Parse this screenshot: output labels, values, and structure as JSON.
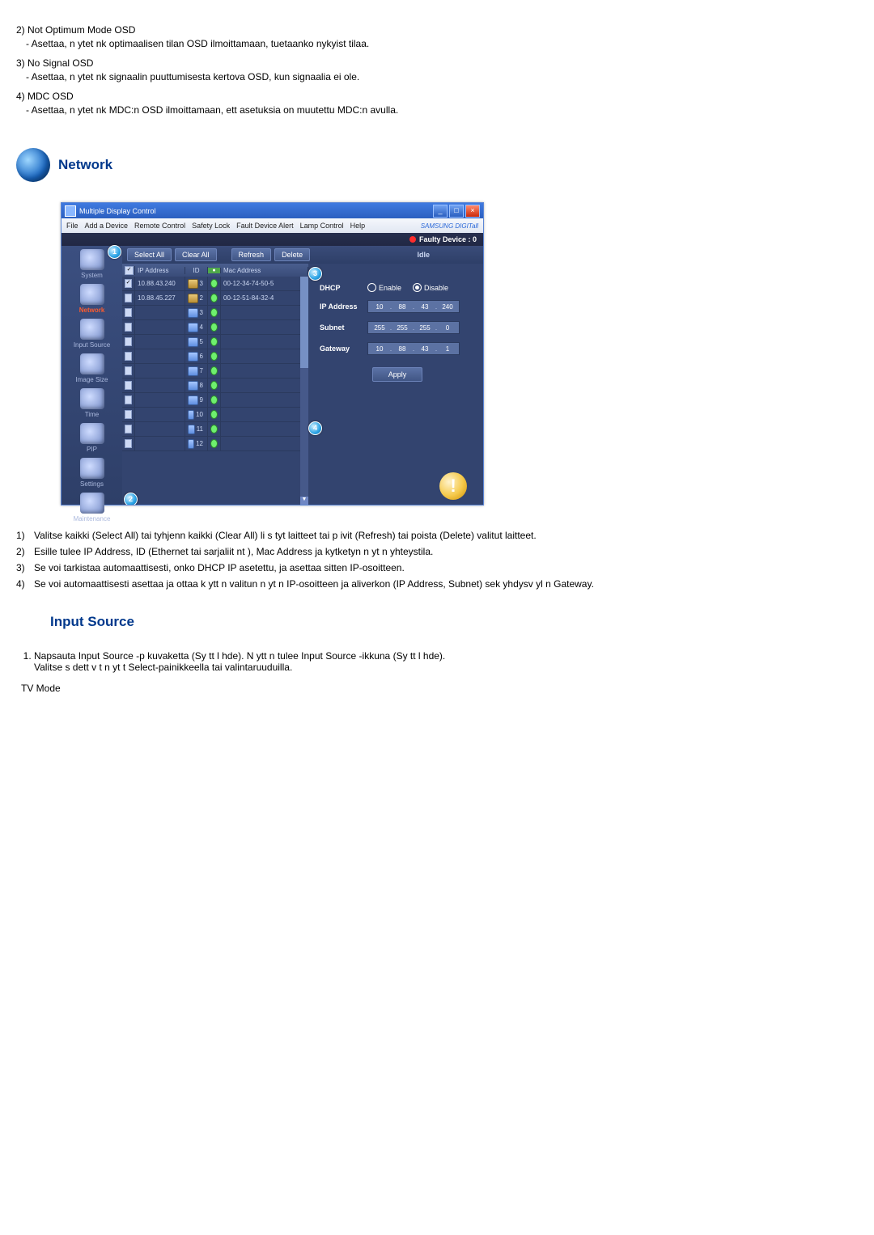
{
  "doc": {
    "items": [
      {
        "n": "2)",
        "title": "Not Optimum Mode OSD",
        "desc": "- Asettaa, n ytet  nk  optimaalisen tilan OSD ilmoittamaan, tuetaanko nykyist  tilaa."
      },
      {
        "n": "3)",
        "title": "No Signal OSD",
        "desc": "- Asettaa, n ytet  nk  signaalin puuttumisesta kertova OSD, kun signaalia ei ole."
      },
      {
        "n": "4)",
        "title": "MDC OSD",
        "desc": "- Asettaa, n ytet  nk  MDC:n OSD ilmoittamaan, ett  asetuksia on muutettu MDC:n avulla."
      }
    ]
  },
  "sections": {
    "network": "Network",
    "input_source": "Input Source"
  },
  "app": {
    "title": "Multiple Display Control",
    "menu": [
      "File",
      "Add a Device",
      "Remote Control",
      "Safety Lock",
      "Fault Device Alert",
      "Lamp Control",
      "Help"
    ],
    "brand": "SAMSUNG DIGITall",
    "faulty": "Faulty Device : 0",
    "toolbar": {
      "select_all": "Select All",
      "clear_all": "Clear All",
      "refresh": "Refresh",
      "delete": "Delete",
      "idle": "Idle"
    },
    "sidebar": [
      {
        "label": "System"
      },
      {
        "label": "Network"
      },
      {
        "label": "Input Source"
      },
      {
        "label": "Image Size"
      },
      {
        "label": "Time"
      },
      {
        "label": "PIP"
      },
      {
        "label": "Settings"
      },
      {
        "label": "Maintenance"
      }
    ],
    "table": {
      "headers": {
        "ip": "IP Address",
        "id": "ID",
        "mac": "Mac Address"
      },
      "rows": [
        {
          "checked": true,
          "ip": "10.88.43.240",
          "badge": "gold",
          "id": "3",
          "mac": "00-12-34-74-50-5"
        },
        {
          "checked": false,
          "ip": "10.88.45.227",
          "badge": "gold",
          "id": "2",
          "mac": "00-12-51-84-32-4"
        },
        {
          "checked": false,
          "ip": "",
          "badge": "blue",
          "id": "3",
          "mac": ""
        },
        {
          "checked": false,
          "ip": "",
          "badge": "blue",
          "id": "4",
          "mac": ""
        },
        {
          "checked": false,
          "ip": "",
          "badge": "blue",
          "id": "5",
          "mac": ""
        },
        {
          "checked": false,
          "ip": "",
          "badge": "blue",
          "id": "6",
          "mac": ""
        },
        {
          "checked": false,
          "ip": "",
          "badge": "blue",
          "id": "7",
          "mac": ""
        },
        {
          "checked": false,
          "ip": "",
          "badge": "blue",
          "id": "8",
          "mac": ""
        },
        {
          "checked": false,
          "ip": "",
          "badge": "blue",
          "id": "9",
          "mac": ""
        },
        {
          "checked": false,
          "ip": "",
          "badge": "blue",
          "id": "10",
          "mac": ""
        },
        {
          "checked": false,
          "ip": "",
          "badge": "blue",
          "id": "11",
          "mac": ""
        },
        {
          "checked": false,
          "ip": "",
          "badge": "blue",
          "id": "12",
          "mac": ""
        }
      ]
    },
    "form": {
      "dhcp": {
        "label": "DHCP",
        "enable": "Enable",
        "disable": "Disable",
        "selected": "disable"
      },
      "ip": {
        "label": "IP Address",
        "seg": [
          "10",
          "88",
          "43",
          "240"
        ]
      },
      "subnet": {
        "label": "Subnet",
        "seg": [
          "255",
          "255",
          "255",
          "0"
        ]
      },
      "gateway": {
        "label": "Gateway",
        "seg": [
          "10",
          "88",
          "43",
          "1"
        ]
      },
      "apply": "Apply"
    },
    "markers": {
      "m1": "1",
      "m2": "2",
      "m3": "3",
      "m4": "4"
    }
  },
  "below": {
    "rows": [
      {
        "n": "1)",
        "t": "Valitse kaikki (Select All) tai tyhjenn  kaikki (Clear All) li s tyt laitteet tai p ivit  (Refresh) tai poista (Delete) valitut laitteet."
      },
      {
        "n": "2)",
        "t": "Esille tulee IP Address, ID (Ethernet tai sarjaliit nt ), Mac Address ja kytketyn n yt n yhteystila."
      },
      {
        "n": "3)",
        "t": "Se voi tarkistaa automaattisesti, onko DHCP IP asetettu, ja asettaa sitten IP-osoitteen."
      },
      {
        "n": "4)",
        "t": "Se voi automaattisesti asettaa ja ottaa k ytt  n valitun n yt n IP-osoitteen ja aliverkon (IP Address, Subnet) sek  yhdysv yl n Gateway."
      }
    ]
  },
  "input_steps": {
    "line1a": "Napsauta Input Source -p  kuvaketta (Sy tt l hde). N ytt  n tulee Input Source -ikkuna (Sy tt l hde).",
    "line1b": "Valitse s  dett v t n yt t Select-painikkeella tai valintaruuduilla.",
    "tv_mode": "TV Mode"
  }
}
